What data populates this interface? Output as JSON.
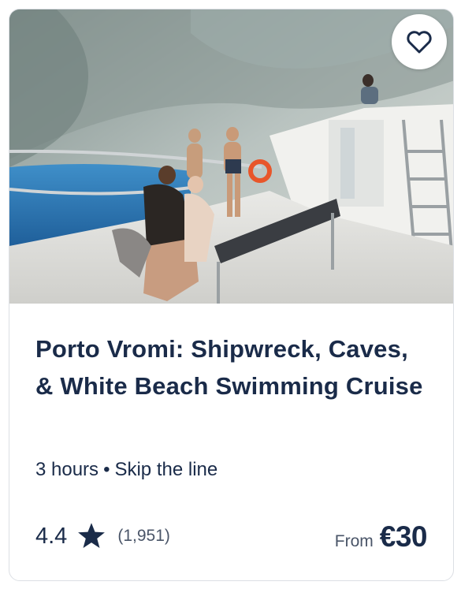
{
  "card": {
    "title": "Porto Vromi: Shipwreck, Caves, & White Beach Swimming Cruise",
    "duration": "3 hours",
    "separator": "•",
    "feature": "Skip the line",
    "rating": "4.4",
    "review_count": "(1,951)",
    "price_prefix": "From",
    "price": "€30",
    "favorite_icon": "heart-outline-icon",
    "rating_icon": "star-filled-icon",
    "colors": {
      "text": "#1a2b49",
      "muted": "#4a5568",
      "border": "#dcdfe4"
    }
  }
}
